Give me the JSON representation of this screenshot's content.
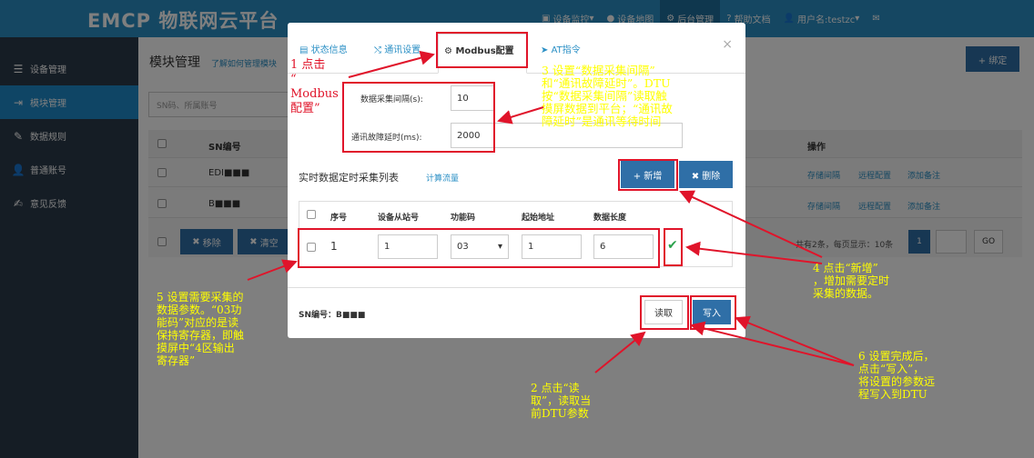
{
  "header": {
    "logo_text": "EMCP 物联网云平台",
    "nav": [
      {
        "label": "设备监控",
        "has_caret": true
      },
      {
        "label": "设备地图",
        "has_caret": false
      },
      {
        "label": "后台管理",
        "has_caret": false,
        "active": true
      },
      {
        "label": "帮助文档",
        "has_caret": false
      },
      {
        "label": "用户名:testzc",
        "has_caret": true
      }
    ],
    "mail_icon": "mail-icon"
  },
  "sidebar": {
    "items": [
      {
        "label": "设备管理",
        "icon": "list-icon"
      },
      {
        "label": "模块管理",
        "icon": "login-icon",
        "active": true
      },
      {
        "label": "数据规则",
        "icon": "pencil-icon"
      },
      {
        "label": "普通账号",
        "icon": "user-icon"
      },
      {
        "label": "意见反馈",
        "icon": "edit-icon"
      }
    ]
  },
  "main": {
    "title": "模块管理",
    "help_link": "了解如何管理模块",
    "bind_button": "+ 绑定",
    "search_placeholder": "SN码、所属账号",
    "table": {
      "headers": {
        "sn": "SN编号",
        "ops": "操作"
      },
      "rows": [
        {
          "sn": "EDI■■■",
          "ops": [
            "存储间隔",
            "远程配置",
            "添加备注"
          ]
        },
        {
          "sn": "B■■■",
          "ops": [
            "存储间隔",
            "远程配置",
            "添加备注"
          ]
        }
      ]
    },
    "remove_button": "移除",
    "clear_button": "清空",
    "pager": {
      "summary": "共有2条，每页显示：10条",
      "current": "1",
      "go": "GO"
    }
  },
  "modal": {
    "tabs": [
      "状态信息",
      "通讯设置",
      "Modbus配置",
      "AT指令"
    ],
    "active_tab": "Modbus配置",
    "fields": {
      "interval_label": "数据采集间隔(s):",
      "interval_value": "10",
      "timeout_label": "通讯故障延时(ms):",
      "timeout_value": "2000"
    },
    "section_title": "实时数据定时采集列表",
    "section_link": "计算流量",
    "add_button": "+ 新增",
    "delete_button": "✖ 删除",
    "table": {
      "headers": [
        "序号",
        "设备从站号",
        "功能码",
        "起始地址",
        "数据长度"
      ],
      "row": {
        "index": "1",
        "slave": "1",
        "func": "03",
        "start": "1",
        "length": "6"
      }
    },
    "sn_label": "SN编号：",
    "sn_value": "B■■■",
    "read_button": "读取",
    "write_button": "写入"
  },
  "annotations": {
    "a1": "1 点击\n“\nModbus\n配置”",
    "a2": "2 点击“读\n取”，读取当\n前DTU参数",
    "a3": "3 设置“数据采集间隔”\n和“通讯故障延时”。DTU\n按“数据采集间隔”读取触\n摸屏数据到平台；“通讯故\n障延时”是通讯等待时间",
    "a4": "4 点击“新增”\n，增加需要定时\n采集的数据。",
    "a5": "5 设置需要采集的\n数据参数。“03功\n能码”对应的是读\n保持寄存器，即触\n摸屏中“4区输出\n寄存器”",
    "a6": "6 设置完成后，\n点击“写入”，\n将设置的参数远\n程写入到DTU"
  },
  "colors": {
    "topbar": "#2a8fc5",
    "sidebar": "#2b3a4a",
    "accent": "#2f6fa7",
    "annotation": "#ffff00",
    "annotation_red": "#e0142a"
  }
}
